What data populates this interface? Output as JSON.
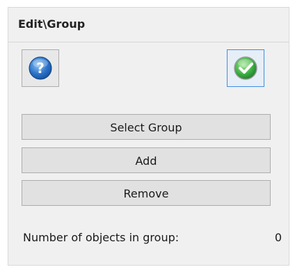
{
  "panel": {
    "title": "Edit\\Group"
  },
  "icons": {
    "help": "help-icon",
    "ok": "checkmark-icon"
  },
  "buttons": {
    "select_group": "Select Group",
    "add": "Add",
    "remove": "Remove"
  },
  "status": {
    "count_label": "Number of objects in group:",
    "count_value": "0"
  },
  "colors": {
    "help_blue": "#2d73c9",
    "ok_green": "#3cb043",
    "focus_border": "#3c8fe0"
  }
}
